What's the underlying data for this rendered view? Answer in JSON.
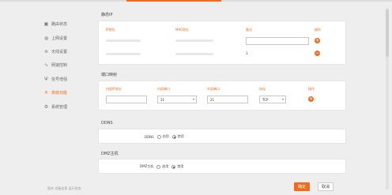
{
  "nav": {
    "items": [
      {
        "label": "路由状态",
        "icon": "dashboard-icon"
      },
      {
        "label": "上网设置",
        "icon": "globe-icon"
      },
      {
        "label": "无线设置",
        "icon": "wifi-icon"
      },
      {
        "label": "网速控制",
        "icon": "speed-icon"
      },
      {
        "label": "信号增强",
        "icon": "signal-icon"
      },
      {
        "label": "高级功能",
        "icon": "tools-icon"
      },
      {
        "label": "系统管理",
        "icon": "settings-icon"
      }
    ],
    "active_index": 5,
    "footer": "版本  设备信息  运行状态"
  },
  "static_ip": {
    "title": "静态IP",
    "headers": [
      "IP地址",
      "MAC地址",
      "备注",
      "操作"
    ],
    "row2_note": "1"
  },
  "port_mapping": {
    "title": "端口映射",
    "headers": [
      "内部IP地址",
      "内部端口",
      "外部端口",
      "协议",
      "操作"
    ],
    "internal_port": "21",
    "external_port": "21",
    "protocol": "TCP"
  },
  "ddns": {
    "title": "DDNS",
    "field_label": "DDNS",
    "options": [
      "启用",
      "禁用"
    ],
    "selected": "禁用"
  },
  "dmz": {
    "title": "DMZ主机",
    "field_label": "DMZ主机",
    "options": [
      "启用",
      "禁用"
    ],
    "selected": "禁用"
  },
  "actions": {
    "save": "确定",
    "cancel": "取消"
  },
  "colors": {
    "accent": "#f26a1b",
    "background": "#eeeeee",
    "panel": "#ffffff"
  }
}
